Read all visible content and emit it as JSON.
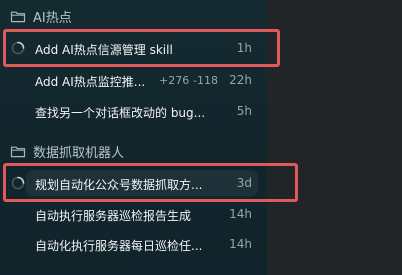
{
  "sidebar": {
    "groups": [
      {
        "title": "AI热点",
        "threads": [
          {
            "title": "Add AI热点信源管理 skill",
            "time": "1h",
            "loading": true
          },
          {
            "title": "Add AI热点监控推...",
            "additions": "+276",
            "deletions": "-118",
            "time": "22h",
            "loading": false
          },
          {
            "title": "查找另一个对话框改动的 bug...",
            "time": "5h",
            "loading": false
          }
        ]
      },
      {
        "title": "数据抓取机器人",
        "threads": [
          {
            "title": "规划自动化公众号数据抓取方...",
            "time": "3d",
            "loading": true
          },
          {
            "title": "自动执行服务器巡检报告生成",
            "time": "14h",
            "loading": false
          },
          {
            "title": "自动化执行服务器每日巡检任...",
            "time": "14h",
            "loading": false
          }
        ]
      }
    ]
  },
  "colors": {
    "sidebar_background": "#13262d",
    "right_panel_background": "#222528",
    "highlight_border": "#e15a5a",
    "primary_text": "#f2f4f5",
    "secondary_text": "#9aa4a8"
  },
  "icons": {
    "folder": "folder-icon",
    "loading": "loading-spinner-icon"
  }
}
